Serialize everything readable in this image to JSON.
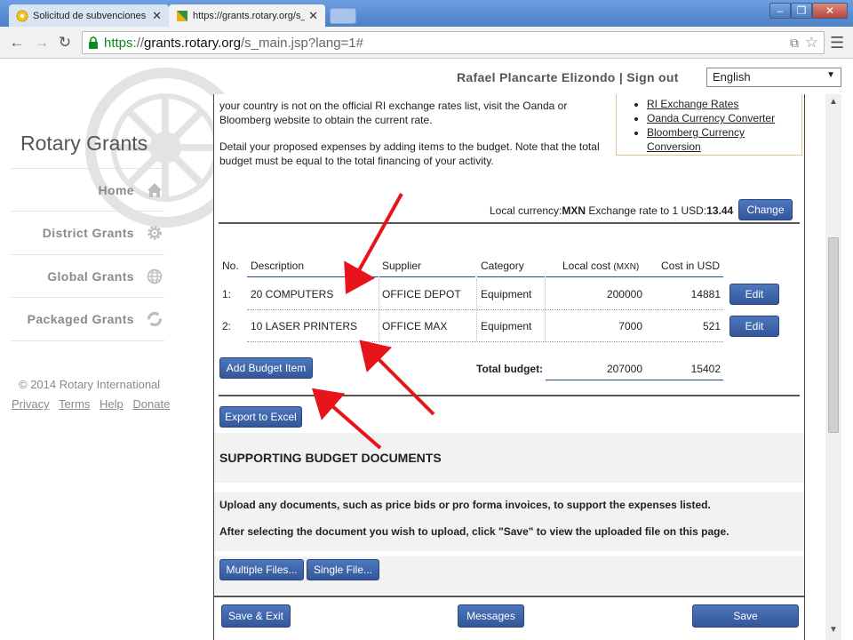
{
  "browser": {
    "tabs": [
      {
        "label": "Solicitud de subvenciones | M",
        "icon": "rotary-favicon"
      },
      {
        "label": "https://grants.rotary.org/s_",
        "icon": "grants-favicon"
      }
    ],
    "url_scheme": "https",
    "url_sep": "://",
    "url_host": "grants.rotary.org",
    "url_path": "/s_main.jsp?lang=1#"
  },
  "header": {
    "user_name": "Rafael Plancarte Elizondo",
    "separator": "|",
    "sign_out": "Sign out",
    "language": "English"
  },
  "sidebar": {
    "brand": "Rotary Grants",
    "items": [
      {
        "label": "Home",
        "icon": "home-icon"
      },
      {
        "label": "District Grants",
        "icon": "gear-icon"
      },
      {
        "label": "Global Grants",
        "icon": "globe-icon"
      },
      {
        "label": "Packaged Grants",
        "icon": "refresh-icon"
      }
    ],
    "copyright": "© 2014 Rotary International",
    "links": [
      "Privacy",
      "Terms",
      "Help",
      "Donate"
    ]
  },
  "intro": {
    "para1": "your country is not on the official RI exchange rates list, visit the Oanda or Bloomberg website to obtain the current rate.",
    "para2": "Detail your proposed expenses by adding items to the budget. Note that the total budget must be equal to the total financing of your activity."
  },
  "rate_links": [
    "RI Exchange Rates",
    "Oanda Currency Converter",
    "Bloomberg Currency Conversion"
  ],
  "currency": {
    "label": "Local currency:",
    "code": "MXN",
    "rate_label": "Exchange rate to 1 USD:",
    "rate": "13.44",
    "change_label": "Change"
  },
  "budget": {
    "columns": {
      "no": "No.",
      "description": "Description",
      "supplier": "Supplier",
      "category": "Category",
      "local_cost": "Local cost",
      "local_cost_unit": "(MXN)",
      "usd": "Cost in USD"
    },
    "rows": [
      {
        "no": "1:",
        "description": "20 COMPUTERS",
        "supplier": "OFFICE DEPOT",
        "category": "Equipment",
        "local_cost": "200000",
        "usd": "14881",
        "edit": "Edit"
      },
      {
        "no": "2:",
        "description": "10 LASER PRINTERS",
        "supplier": "OFFICE MAX",
        "category": "Equipment",
        "local_cost": "7000",
        "usd": "521",
        "edit": "Edit"
      }
    ],
    "add_item": "Add Budget Item",
    "total_label": "Total budget:",
    "total_local": "207000",
    "total_usd": "15402"
  },
  "export_label": "Export to Excel",
  "supporting": {
    "title": "SUPPORTING BUDGET DOCUMENTS",
    "line1": "Upload any documents, such as price bids or pro forma invoices, to support the expenses listed.",
    "line2": "After selecting the document you wish to upload, click \"Save\" to view the uploaded file on this page.",
    "multiple": "Multiple Files...",
    "single": "Single File..."
  },
  "footer_buttons": {
    "save_exit": "Save & Exit",
    "messages": "Messages",
    "save": "Save"
  },
  "colors": {
    "button_blue": "#3f64a8",
    "annotation_red": "#e8141c",
    "url_green": "#0a8a1f"
  }
}
